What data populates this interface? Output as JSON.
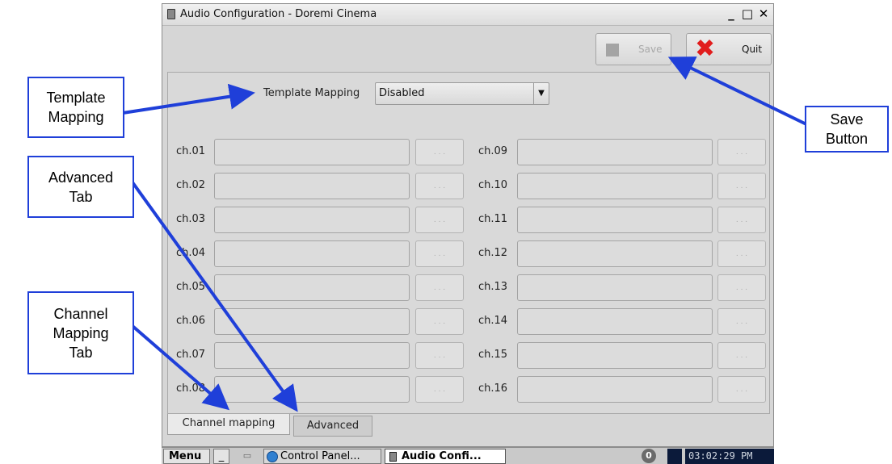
{
  "window": {
    "title": "Audio Configuration - Doremi Cinema",
    "minimize_glyph": "_",
    "maximize_glyph": "□",
    "close_glyph": "✕"
  },
  "toolbar": {
    "save_label": "Save",
    "quit_label": "Quit"
  },
  "template_mapping": {
    "label": "Template Mapping",
    "value": "Disabled"
  },
  "channels_left": [
    {
      "label": "ch.01",
      "btn": ". . ."
    },
    {
      "label": "ch.02",
      "btn": ". . ."
    },
    {
      "label": "ch.03",
      "btn": ". . ."
    },
    {
      "label": "ch.04",
      "btn": ". . ."
    },
    {
      "label": "ch.05",
      "btn": ". . ."
    },
    {
      "label": "ch.06",
      "btn": ". . ."
    },
    {
      "label": "ch.07",
      "btn": ". . ."
    },
    {
      "label": "ch.08",
      "btn": ". . ."
    }
  ],
  "channels_right": [
    {
      "label": "ch.09",
      "btn": ". . ."
    },
    {
      "label": "ch.10",
      "btn": ". . ."
    },
    {
      "label": "ch.11",
      "btn": ". . ."
    },
    {
      "label": "ch.12",
      "btn": ". . ."
    },
    {
      "label": "ch.13",
      "btn": ". . ."
    },
    {
      "label": "ch.14",
      "btn": ". . ."
    },
    {
      "label": "ch.15",
      "btn": ". . ."
    },
    {
      "label": "ch.16",
      "btn": ". . ."
    }
  ],
  "tabs": [
    {
      "label": "Channel mapping",
      "active": true
    },
    {
      "label": "Advanced",
      "active": false
    }
  ],
  "taskbar": {
    "menu": "Menu",
    "min": "_",
    "control_panel": "Control Panel...",
    "audio_config": "Audio Confi...",
    "notification_count": "0",
    "clock": "03:02:29 PM"
  },
  "callouts": {
    "template_mapping": [
      "Template",
      "Mapping"
    ],
    "advanced_tab": [
      "Advanced",
      "Tab"
    ],
    "channel_mapping_tab": [
      "Channel",
      "Mapping",
      "Tab"
    ],
    "save_button": [
      "Save",
      "Button"
    ]
  },
  "colors": {
    "callout_blue": "#1f3fd9",
    "quit_red": "#e11d1d",
    "clock_bg": "#0b1a3a"
  }
}
